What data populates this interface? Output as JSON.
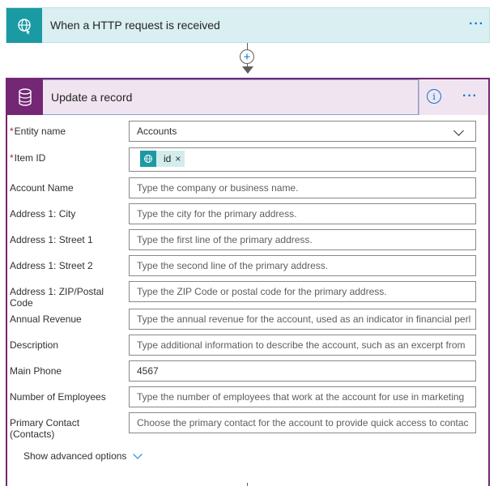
{
  "trigger": {
    "title": "When a HTTP request is received",
    "icon": "globe-icon",
    "more_label": "···",
    "color": "#1c9aa4"
  },
  "connector": {
    "add_label": "+"
  },
  "action": {
    "title": "Update a record",
    "icon": "database-icon",
    "info_label": "i",
    "more_label": "···",
    "color": "#742774"
  },
  "fields": {
    "entity_name": {
      "label": "Entity name",
      "required_mark": "*",
      "value": "Accounts"
    },
    "item_id": {
      "label": "Item ID",
      "required_mark": "*",
      "token": "id",
      "token_remove": "×"
    },
    "account_name": {
      "label": "Account Name",
      "placeholder": "Type the company or business name."
    },
    "city": {
      "label": "Address 1: City",
      "placeholder": "Type the city for the primary address."
    },
    "street1": {
      "label": "Address 1: Street 1",
      "placeholder": "Type the first line of the primary address."
    },
    "street2": {
      "label": "Address 1: Street 2",
      "placeholder": "Type the second line of the primary address."
    },
    "zip": {
      "label": "Address 1: ZIP/Postal Code",
      "placeholder": "Type the ZIP Code or postal code for the primary address."
    },
    "revenue": {
      "label": "Annual Revenue",
      "placeholder": "Type the annual revenue for the account, used as an indicator in financial perl"
    },
    "description": {
      "label": "Description",
      "placeholder": "Type additional information to describe the account, such as an excerpt from"
    },
    "main_phone": {
      "label": "Main Phone",
      "value": "4567"
    },
    "employees": {
      "label": "Number of Employees",
      "placeholder": "Type the number of employees that work at the account for use in marketing"
    },
    "primary_contact": {
      "label": "Primary Contact (Contacts)",
      "placeholder": "Choose the primary contact for the account to provide quick access to contac"
    }
  },
  "advanced_label": "Show advanced options"
}
